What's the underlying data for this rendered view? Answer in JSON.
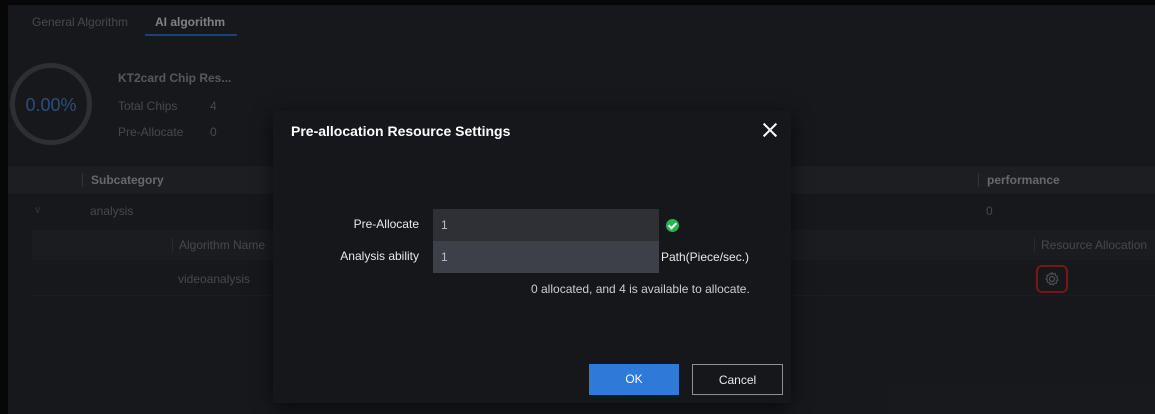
{
  "tabs": [
    {
      "label": "General Algorithm",
      "active": false
    },
    {
      "label": "AI algorithm",
      "active": true
    }
  ],
  "summary": {
    "usage_percent": "0.00%",
    "title": "KT2card Chip Res...",
    "total_chips_label": "Total Chips",
    "total_chips_value": "4",
    "pre_allocate_label": "Pre-Allocate",
    "pre_allocate_value": "0"
  },
  "table": {
    "headers": [
      "Subcategory",
      "performance"
    ],
    "row": {
      "subcategory": "analysis",
      "performance": "0"
    },
    "sub_headers": [
      "Algorithm Name",
      "Resource Allocation"
    ],
    "sub_row": {
      "algorithm_name": "videoanalysis",
      "allocation_icon": "gear-icon"
    }
  },
  "modal": {
    "title": "Pre-allocation Resource Settings",
    "pre_allocate_label": "Pre-Allocate",
    "pre_allocate_value": "1",
    "analysis_label": "Analysis ability",
    "analysis_value": "1",
    "analysis_unit": "Path(Piece/sec.)",
    "allocation_message": "0 allocated, and 4 is available to allocate.",
    "ok_label": "OK",
    "cancel_label": "Cancel"
  },
  "colors": {
    "accent": "#2f7ad8",
    "valid": "#27b54a",
    "highlight": "#e0262f"
  }
}
